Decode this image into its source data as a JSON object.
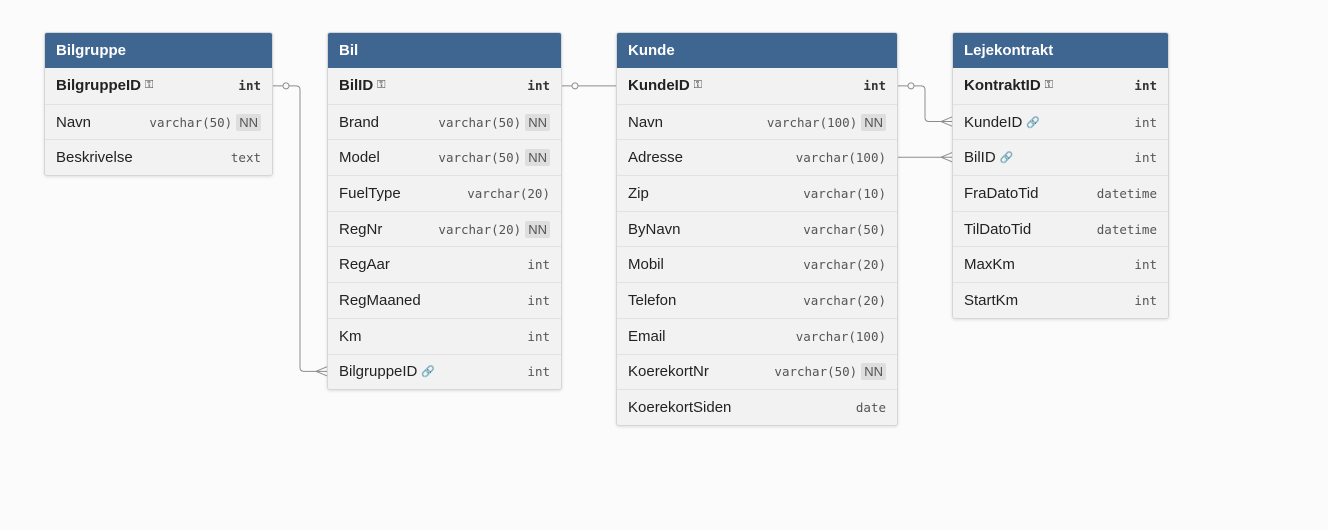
{
  "tables": {
    "bilgruppe": {
      "name": "Bilgruppe",
      "fields": [
        {
          "name": "BilgruppeID",
          "type": "int",
          "pk": true,
          "fk": false,
          "nn": false
        },
        {
          "name": "Navn",
          "type": "varchar(50)",
          "pk": false,
          "fk": false,
          "nn": true
        },
        {
          "name": "Beskrivelse",
          "type": "text",
          "pk": false,
          "fk": false,
          "nn": false
        }
      ]
    },
    "bil": {
      "name": "Bil",
      "fields": [
        {
          "name": "BilID",
          "type": "int",
          "pk": true,
          "fk": false,
          "nn": false
        },
        {
          "name": "Brand",
          "type": "varchar(50)",
          "pk": false,
          "fk": false,
          "nn": true
        },
        {
          "name": "Model",
          "type": "varchar(50)",
          "pk": false,
          "fk": false,
          "nn": true
        },
        {
          "name": "FuelType",
          "type": "varchar(20)",
          "pk": false,
          "fk": false,
          "nn": false
        },
        {
          "name": "RegNr",
          "type": "varchar(20)",
          "pk": false,
          "fk": false,
          "nn": true
        },
        {
          "name": "RegAar",
          "type": "int",
          "pk": false,
          "fk": false,
          "nn": false
        },
        {
          "name": "RegMaaned",
          "type": "int",
          "pk": false,
          "fk": false,
          "nn": false
        },
        {
          "name": "Km",
          "type": "int",
          "pk": false,
          "fk": false,
          "nn": false
        },
        {
          "name": "BilgruppeID",
          "type": "int",
          "pk": false,
          "fk": true,
          "nn": false
        }
      ]
    },
    "kunde": {
      "name": "Kunde",
      "fields": [
        {
          "name": "KundeID",
          "type": "int",
          "pk": true,
          "fk": false,
          "nn": false
        },
        {
          "name": "Navn",
          "type": "varchar(100)",
          "pk": false,
          "fk": false,
          "nn": true
        },
        {
          "name": "Adresse",
          "type": "varchar(100)",
          "pk": false,
          "fk": false,
          "nn": false
        },
        {
          "name": "Zip",
          "type": "varchar(10)",
          "pk": false,
          "fk": false,
          "nn": false
        },
        {
          "name": "ByNavn",
          "type": "varchar(50)",
          "pk": false,
          "fk": false,
          "nn": false
        },
        {
          "name": "Mobil",
          "type": "varchar(20)",
          "pk": false,
          "fk": false,
          "nn": false
        },
        {
          "name": "Telefon",
          "type": "varchar(20)",
          "pk": false,
          "fk": false,
          "nn": false
        },
        {
          "name": "Email",
          "type": "varchar(100)",
          "pk": false,
          "fk": false,
          "nn": false
        },
        {
          "name": "KoerekortNr",
          "type": "varchar(50)",
          "pk": false,
          "fk": false,
          "nn": true
        },
        {
          "name": "KoerekortSiden",
          "type": "date",
          "pk": false,
          "fk": false,
          "nn": false
        }
      ]
    },
    "lejekontrakt": {
      "name": "Lejekontrakt",
      "fields": [
        {
          "name": "KontraktID",
          "type": "int",
          "pk": true,
          "fk": false,
          "nn": false
        },
        {
          "name": "KundeID",
          "type": "int",
          "pk": false,
          "fk": true,
          "nn": false
        },
        {
          "name": "BilID",
          "type": "int",
          "pk": false,
          "fk": true,
          "nn": false
        },
        {
          "name": "FraDatoTid",
          "type": "datetime",
          "pk": false,
          "fk": false,
          "nn": false
        },
        {
          "name": "TilDatoTid",
          "type": "datetime",
          "pk": false,
          "fk": false,
          "nn": false
        },
        {
          "name": "MaxKm",
          "type": "int",
          "pk": false,
          "fk": false,
          "nn": false
        },
        {
          "name": "StartKm",
          "type": "int",
          "pk": false,
          "fk": false,
          "nn": false
        }
      ]
    }
  },
  "labels": {
    "not_null": "NN",
    "pk_icon": "key-icon",
    "fk_icon": "link-icon"
  },
  "relationships": [
    {
      "from": "bilgruppe.BilgruppeID",
      "to": "bil.BilgruppeID",
      "cardinality": "one-to-many"
    },
    {
      "from": "bil.BilID",
      "to": "lejekontrakt.BilID",
      "cardinality": "one-to-many"
    },
    {
      "from": "kunde.KundeID",
      "to": "lejekontrakt.KundeID",
      "cardinality": "one-to-many"
    }
  ],
  "colors": {
    "header": "#3f6591",
    "header_text": "#ffffff",
    "body": "#f2f2f2",
    "connector": "#8c8c8c",
    "background": "#fbfbfb"
  }
}
